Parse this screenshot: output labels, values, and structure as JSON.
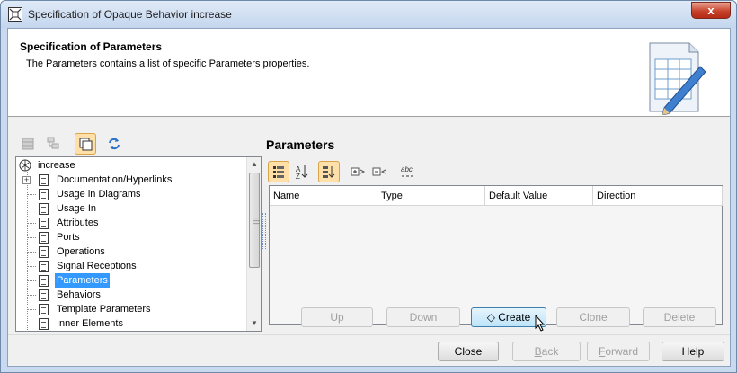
{
  "window": {
    "title": "Specification of Opaque Behavior increase",
    "close_glyph": "x"
  },
  "header": {
    "title": "Specification of Parameters",
    "description": "The Parameters contains a list of specific Parameters properties."
  },
  "tree": {
    "root": "increase",
    "items": [
      {
        "label": "Documentation/Hyperlinks",
        "expandable": true
      },
      {
        "label": "Usage in Diagrams"
      },
      {
        "label": "Usage In"
      },
      {
        "label": "Attributes"
      },
      {
        "label": "Ports"
      },
      {
        "label": "Operations"
      },
      {
        "label": "Signal Receptions"
      },
      {
        "label": "Parameters",
        "selected": true
      },
      {
        "label": "Behaviors"
      },
      {
        "label": "Template Parameters"
      },
      {
        "label": "Inner Elements"
      }
    ]
  },
  "panel": {
    "title": "Parameters",
    "columns": [
      "Name",
      "Type",
      "Default Value",
      "Direction"
    ],
    "buttons": {
      "up": "Up",
      "down": "Down",
      "create": "Create",
      "clone": "Clone",
      "delete": "Delete"
    }
  },
  "footer": {
    "close": "Close",
    "back_prefix": "",
    "back_mnemonic": "B",
    "back_rest": "ack",
    "forward_prefix": "",
    "forward_mnemonic": "F",
    "forward_rest": "orward",
    "help": "Help"
  },
  "icons": {
    "app": "diagram-frame-icon",
    "header": "table-with-pencil-icon"
  },
  "colors": {
    "selection": "#3399ff",
    "active_toolbar": "#ffe0a8",
    "close_button": "#c7432c"
  }
}
